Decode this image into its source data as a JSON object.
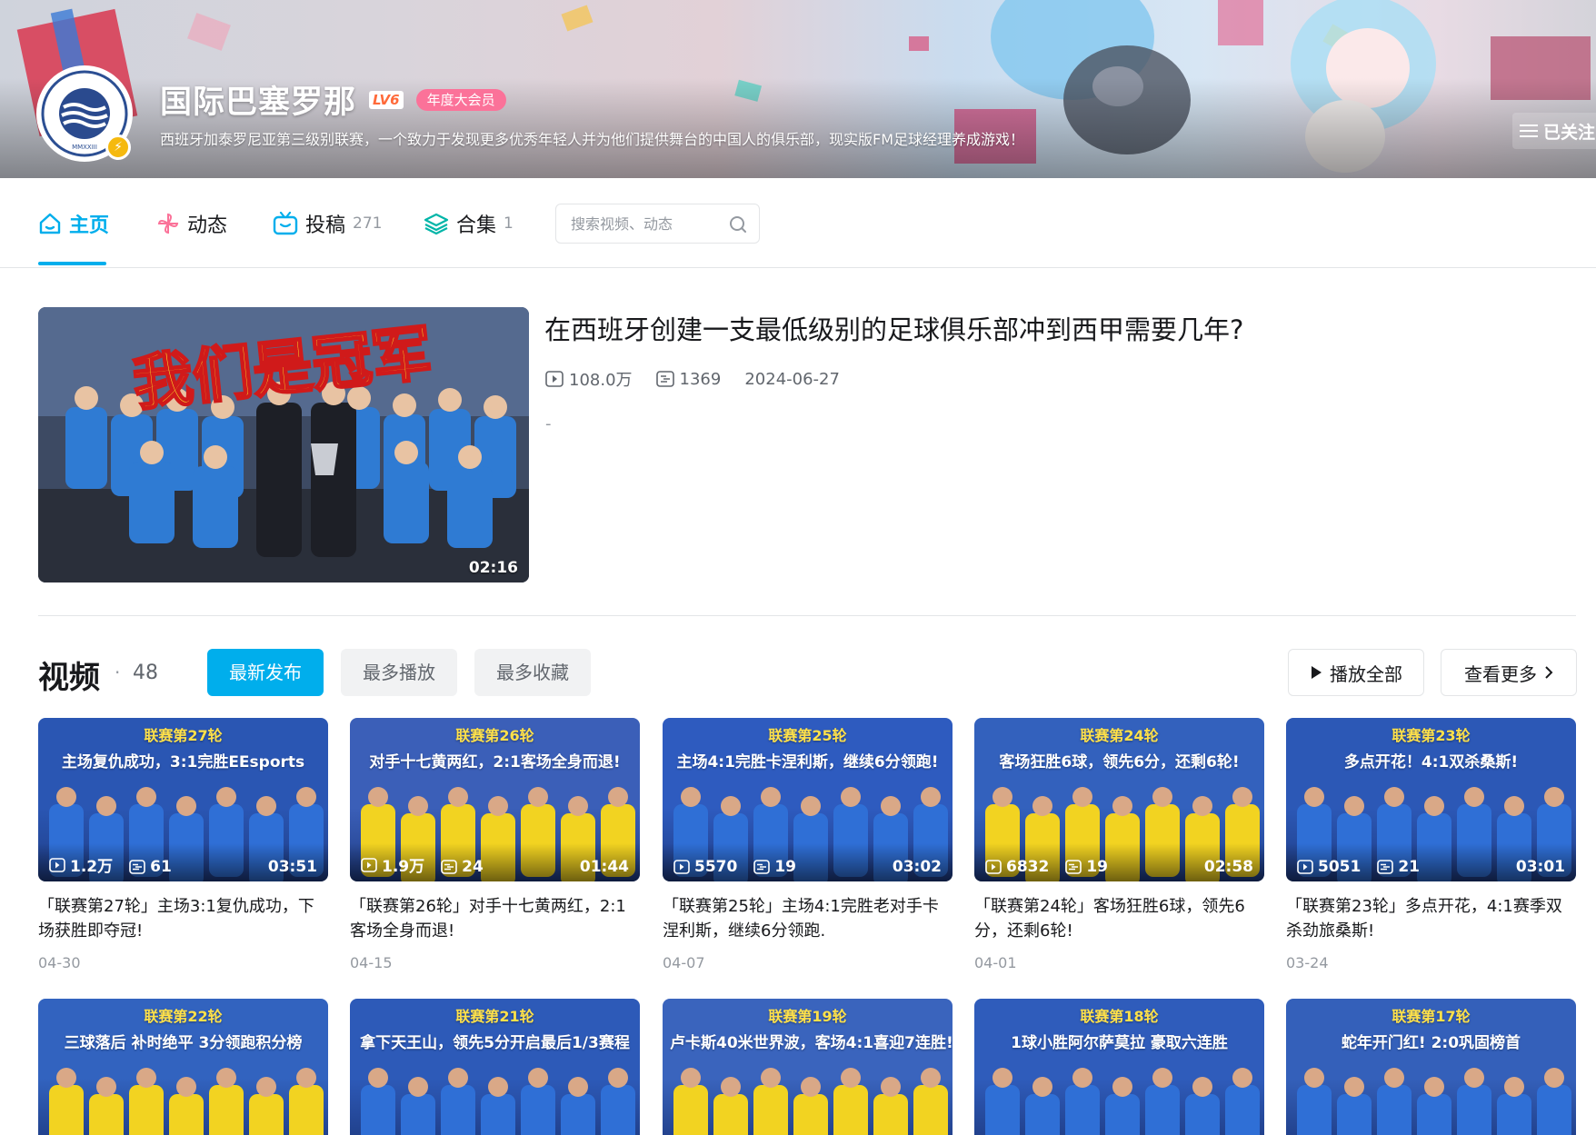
{
  "profile": {
    "name": "国际巴塞罗那",
    "level": "LV6",
    "vip": "年度大会员",
    "sign": "西班牙加泰罗尼亚第三级别联赛，一个致力于发现更多优秀年轻人并为他们提供舞台的中国人的俱乐部，现实版FM足球经理养成游戏！",
    "follow_label": "已关注",
    "avatar_text": "MMXXIII"
  },
  "nav": {
    "tabs": [
      {
        "label": "主页",
        "count": ""
      },
      {
        "label": "动态",
        "count": ""
      },
      {
        "label": "投稿",
        "count": "271"
      },
      {
        "label": "合集",
        "count": "1"
      }
    ],
    "search_placeholder": "搜索视频、动态"
  },
  "featured": {
    "title": "在西班牙创建一支最低级别的足球俱乐部冲到西甲需要几年?",
    "views": "108.0万",
    "danmaku": "1369",
    "date": "2024-06-27",
    "desc": "-",
    "duration": "02:16",
    "thumb_text": "我们是冠军"
  },
  "videos_section": {
    "title": "视频",
    "dot": "·",
    "count": "48",
    "filters": [
      "最新发布",
      "最多播放",
      "最多收藏"
    ],
    "play_all": "播放全部",
    "see_more": "查看更多"
  },
  "videos": [
    {
      "round": "联赛第27轮",
      "sub": "主场复仇成功，3:1完胜EEsports",
      "views": "1.2万",
      "danmaku": "61",
      "duration": "03:51",
      "title": "「联赛第27轮」主场3:1复仇成功，下场获胜即夺冠!",
      "date": "04-30",
      "bg": "#2a56b3"
    },
    {
      "round": "联赛第26轮",
      "sub": "对手十七黄两红，2:1客场全身而退!",
      "views": "1.9万",
      "danmaku": "24",
      "duration": "01:44",
      "title": "「联赛第26轮」对手十七黄两红，2:1客场全身而退!",
      "date": "04-15",
      "bg": "#3b5fb8"
    },
    {
      "round": "联赛第25轮",
      "sub": "主场4:1完胜卡涅利斯，继续6分领跑!",
      "views": "5570",
      "danmaku": "19",
      "duration": "03:02",
      "title": "「联赛第25轮」主场4:1完胜老对手卡涅利斯，继续6分领跑.",
      "date": "04-07",
      "bg": "#2e5bbf"
    },
    {
      "round": "联赛第24轮",
      "sub": "客场狂胜6球，领先6分，还剩6轮!",
      "views": "6832",
      "danmaku": "19",
      "duration": "02:58",
      "title": "「联赛第24轮」客场狂胜6球，领先6分，还剩6轮!",
      "date": "04-01",
      "bg": "#3361bd"
    },
    {
      "round": "联赛第23轮",
      "sub": "多点开花！4:1双杀桑斯!",
      "views": "5051",
      "danmaku": "21",
      "duration": "03:01",
      "title": "「联赛第23轮」多点开花，4:1赛季双杀劲旅桑斯!",
      "date": "03-24",
      "bg": "#2c58b6"
    },
    {
      "round": "联赛第22轮",
      "sub": "三球落后 补时绝平 3分领跑积分榜",
      "bg": "#3263bf"
    },
    {
      "round": "联赛第21轮",
      "sub": "拿下天王山，领先5分开启最后1/3赛程",
      "bg": "#2d5ab8"
    },
    {
      "round": "联赛第19轮",
      "sub": "卢卡斯40米世界波，客场4:1喜迎7连胜!",
      "bg": "#3a64bd"
    },
    {
      "round": "联赛第18轮",
      "sub": "1球小胜阿尔萨莫拉 豪取六连胜",
      "bg": "#2f5cbb"
    },
    {
      "round": "联赛第17轮",
      "sub": "蛇年开门红! 2:0巩固榜首",
      "bg": "#3460ba"
    }
  ]
}
